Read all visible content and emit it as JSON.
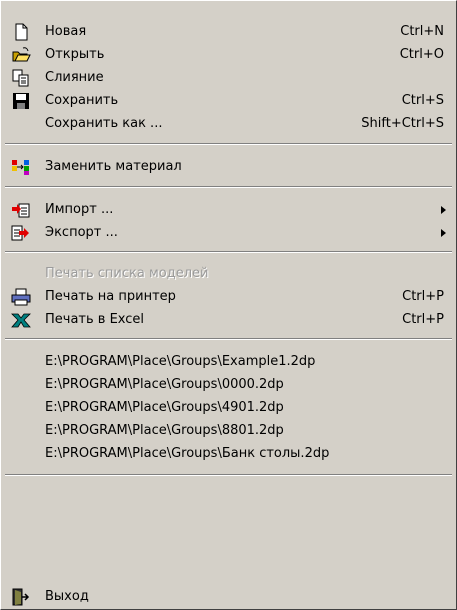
{
  "menu": {
    "items": [
      {
        "label": "Новая",
        "shortcut": "Ctrl+N",
        "icon": "new-document-icon"
      },
      {
        "label": "Открыть",
        "shortcut": "Ctrl+O",
        "icon": "open-folder-icon"
      },
      {
        "label": "Слияние",
        "shortcut": "",
        "icon": "merge-icon"
      },
      {
        "label": "Сохранить",
        "shortcut": "Ctrl+S",
        "icon": "save-disk-icon"
      },
      {
        "label": "Сохранить как ...",
        "shortcut": "Shift+Ctrl+S",
        "icon": ""
      },
      {
        "label": "Заменить материал",
        "shortcut": "",
        "icon": "replace-material-icon"
      },
      {
        "label": "Импорт ...",
        "shortcut": "",
        "icon": "import-icon"
      },
      {
        "label": "Экспорт ...",
        "shortcut": "",
        "icon": "export-icon"
      },
      {
        "label": "Печать списка моделей",
        "shortcut": "",
        "icon": "",
        "disabled": true
      },
      {
        "label": "Печать на принтер",
        "shortcut": "Ctrl+P",
        "icon": "printer-icon"
      },
      {
        "label": "Печать в Excel",
        "shortcut": "Ctrl+P",
        "icon": "excel-icon"
      },
      {
        "label": "E:\\PROGRAM\\Place\\Groups\\Example1.2dp"
      },
      {
        "label": "E:\\PROGRAM\\Place\\Groups\\0000.2dp"
      },
      {
        "label": "E:\\PROGRAM\\Place\\Groups\\4901.2dp"
      },
      {
        "label": "E:\\PROGRAM\\Place\\Groups\\8801.2dp"
      },
      {
        "label": "E:\\PROGRAM\\Place\\Groups\\Банк столы.2dp"
      },
      {
        "label": "Выход",
        "shortcut": "",
        "icon": "exit-door-icon"
      }
    ]
  }
}
